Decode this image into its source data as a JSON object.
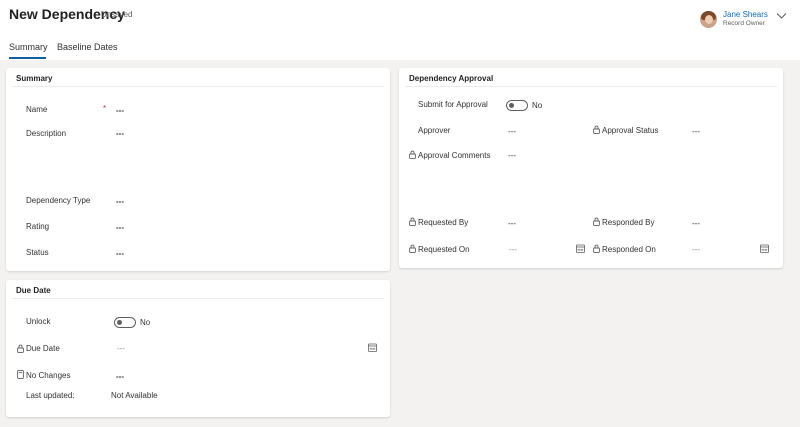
{
  "header": {
    "title": "New Dependency",
    "status": "- Unsaved",
    "user_name": "Jane Shears",
    "user_role": "Record Owner",
    "chevron_icon": "chevron-down-icon",
    "avatar_icon": "avatar-icon"
  },
  "tabs": [
    {
      "label": "Summary",
      "selected": true
    },
    {
      "label": "Baseline Dates",
      "selected": false
    }
  ],
  "summary": {
    "title": "Summary",
    "name_label": "Name",
    "name_required": "*",
    "name_value": "---",
    "description_label": "Description",
    "description_value": "---",
    "dependency_type_label": "Dependency Type",
    "dependency_type_value": "---",
    "rating_label": "Rating",
    "rating_value": "---",
    "status_label": "Status",
    "status_value": "---"
  },
  "due_date": {
    "title": "Due Date",
    "unlock_label": "Unlock",
    "unlock_toggle": "No",
    "due_date_label": "Due Date",
    "due_date_value": "---",
    "no_changes_label": "No Changes",
    "no_changes_value": "---",
    "last_updated_label": "Last updated:",
    "last_updated_value": "Not Available"
  },
  "approval": {
    "title": "Dependency Approval",
    "submit_label": "Submit for Approval",
    "submit_toggle": "No",
    "approver_label": "Approver",
    "approver_value": "---",
    "approval_status_label": "Approval Status",
    "approval_status_value": "---",
    "approval_comments_label": "Approval Comments",
    "approval_comments_value": "---",
    "requested_by_label": "Requested By",
    "requested_by_value": "---",
    "responded_by_label": "Responded By",
    "responded_by_value": "---",
    "requested_on_label": "Requested On",
    "requested_on_value": "---",
    "responded_on_label": "Responded On",
    "responded_on_value": "---"
  },
  "colors": {
    "accent": "#115ea3",
    "link": "#0f6cbd",
    "required": "#c4314b",
    "background": "#f3f2f1"
  }
}
